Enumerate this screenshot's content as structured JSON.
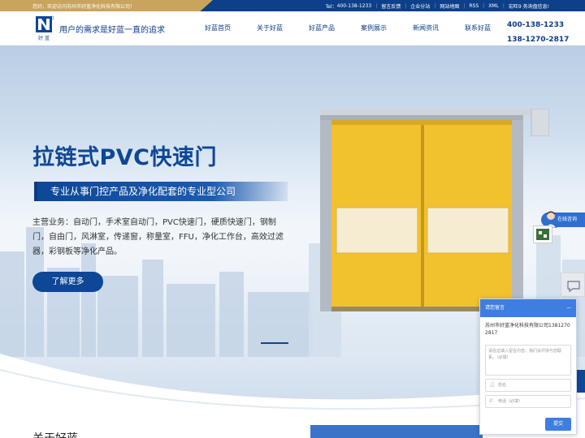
{
  "topbar": {
    "welcome": "您好，欢迎访问苏州市好蓝净化科技有限公司！",
    "tel_label": "Tel：",
    "tel": "400-138-1233",
    "links": [
      "留言反馈",
      "企业分站",
      "网站地图",
      "RSS",
      "XML",
      "宏旺9 务询盘信息!"
    ]
  },
  "header": {
    "logo_text": "好 蓝",
    "slogan": "用户的需求是好蓝一直的追求",
    "nav": [
      "好蓝首页",
      "关于好蓝",
      "好蓝产品",
      "案例展示",
      "新闻资讯",
      "联系好蓝"
    ],
    "phones": [
      "400-138-1233",
      "138-1270-2817"
    ]
  },
  "hero": {
    "title": "拉链式PVC快速门",
    "subtitle": "专业从事门控产品及净化配套的专业型公司",
    "description": "主营业务：自动门，手术室自动门，PVC快速门，硬质快速门，钢制门，自由门，风淋室，传递窗，称量室，FFU，净化工作台，高效过滤器，彩钢板等净化产品。",
    "button": "了解更多"
  },
  "about": {
    "title": "关于好蓝"
  },
  "float": {
    "online": "在线咨询"
  },
  "chat": {
    "header": "请您留言",
    "close": "—",
    "company": "苏州市好蓝净化科技有限公司13812702817",
    "message_placeholder": "请在这填入留言内容，我们会尽快与您联系。（必填）",
    "name_placeholder": "姓名",
    "phone_placeholder": "电话（必填）",
    "submit": "提交"
  },
  "colors": {
    "brand": "#0d4796",
    "gold": "#c9a45c",
    "door": "#f2c12e"
  }
}
